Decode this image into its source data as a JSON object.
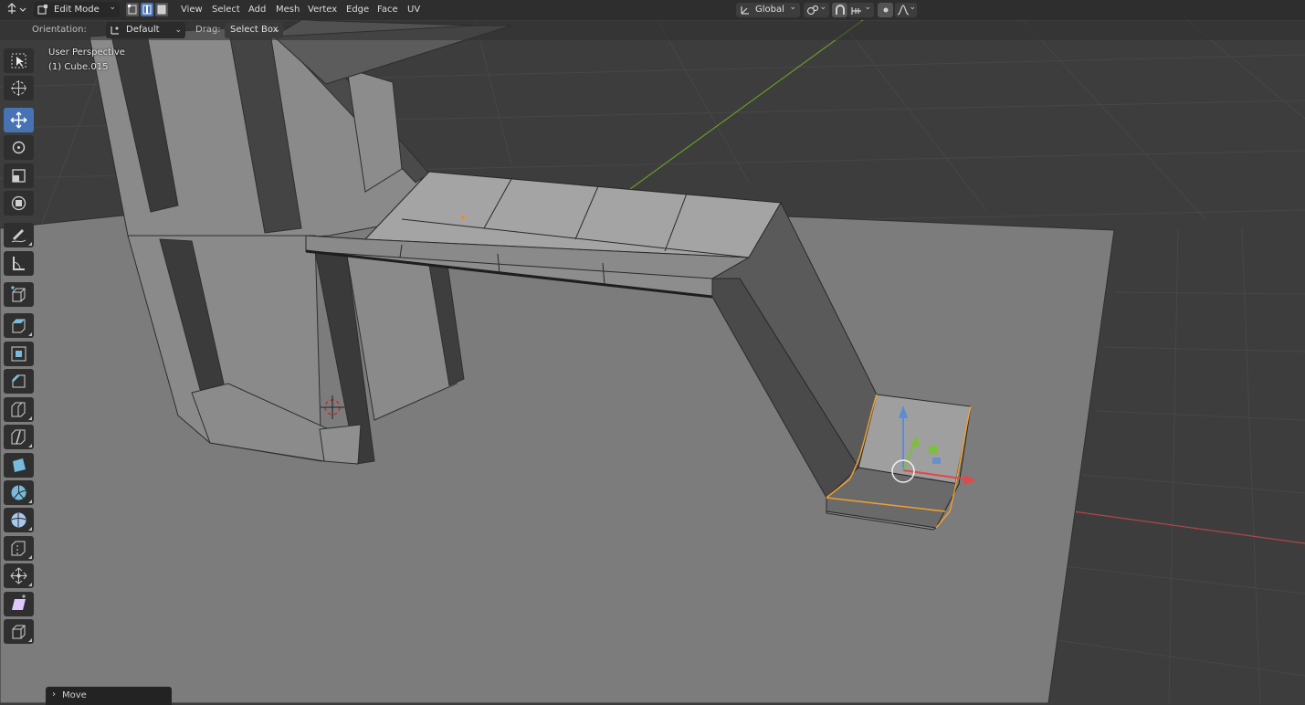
{
  "header": {
    "mode_label": "Edit Mode",
    "menus": [
      "View",
      "Select",
      "Add",
      "Mesh",
      "Vertex",
      "Edge",
      "Face",
      "UV"
    ],
    "transform_orientation": "Global",
    "select_mode_active": "edge",
    "icons": [
      "editor-type-icon",
      "edit-mode-icon",
      "vertex-select-icon",
      "edge-select-icon",
      "face-select-icon",
      "transform-orientation-icon",
      "pivot-point-icon",
      "snap-icon",
      "snap-target-icon",
      "proportional-edit-icon",
      "falloff-icon"
    ]
  },
  "tool_settings": {
    "orientation_label": "Orientation:",
    "orientation_value": "Default",
    "drag_label": "Drag:",
    "drag_value": "Select Box"
  },
  "viewport": {
    "perspective_label": "User Perspective",
    "object_label": "(1) Cube.015",
    "colors": {
      "background": "#3d3d3d",
      "grid": "#4a4a4a",
      "x_axis": "#b3444a",
      "y_axis": "#6a9a28",
      "selection": "#f0a030"
    }
  },
  "toolbar": {
    "active_tool": "move",
    "tools": [
      "select-box",
      "cursor",
      "move",
      "rotate",
      "scale",
      "transform",
      "annotate",
      "measure",
      "add-cube",
      "extrude-region",
      "inset-faces",
      "bevel",
      "loop-cut",
      "knife",
      "poly-build",
      "spin",
      "smooth",
      "edge-slide",
      "shrink-fatten",
      "shear",
      "rip-region"
    ]
  },
  "redo_panel": {
    "label": "Move"
  }
}
